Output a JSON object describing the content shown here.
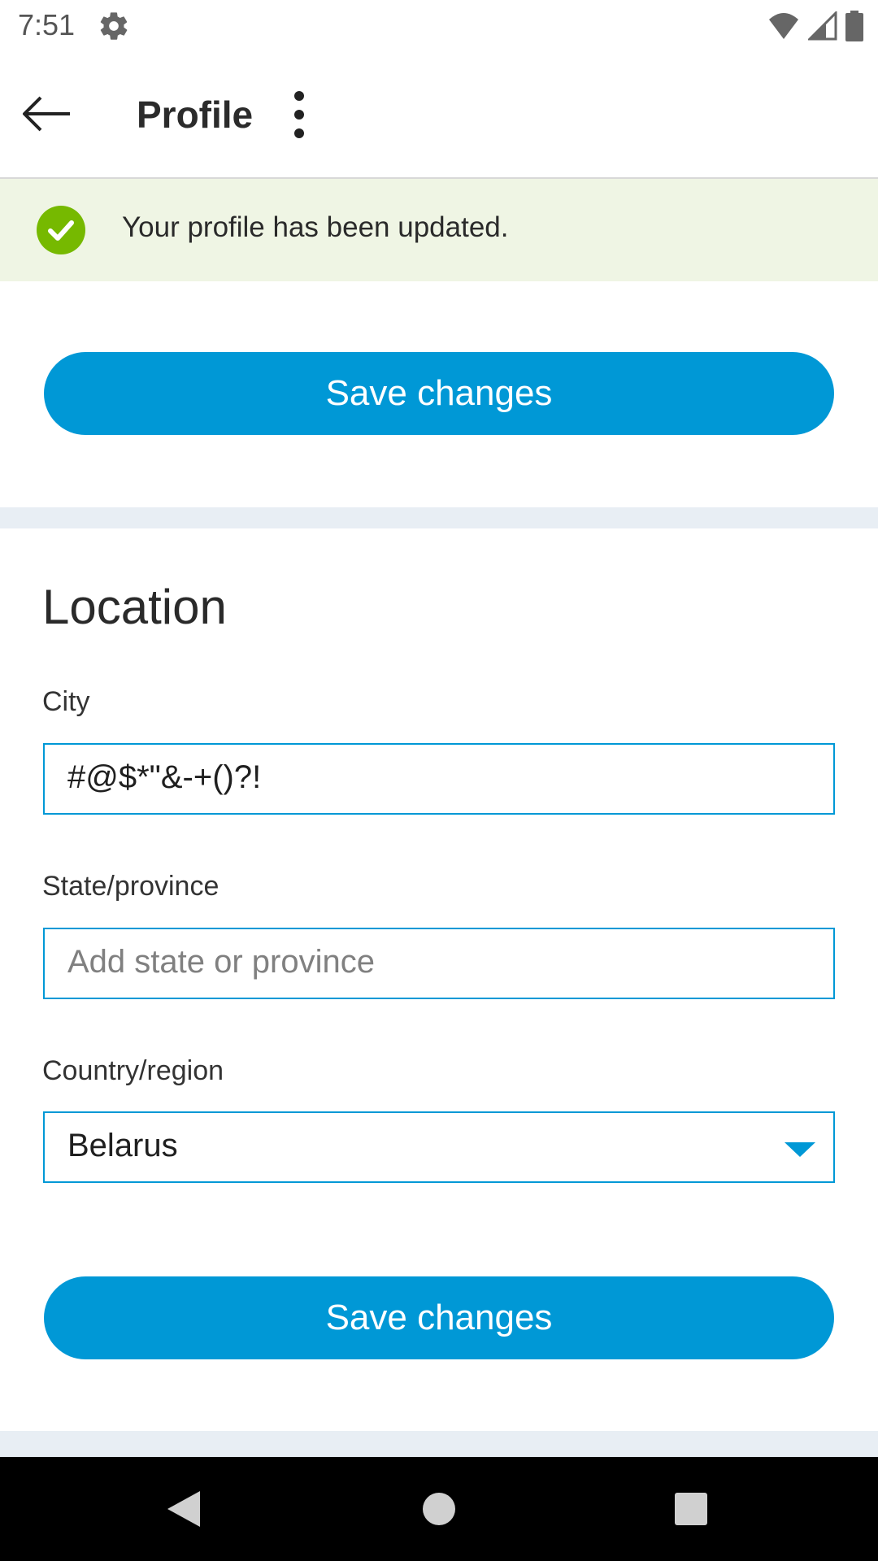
{
  "status_bar": {
    "time": "7:51"
  },
  "app_bar": {
    "title": "Profile"
  },
  "banner": {
    "message": "Your profile has been updated.",
    "accent": "#76b900"
  },
  "buttons": {
    "save_top": "Save changes",
    "save_bottom": "Save changes",
    "color": "#0098d6"
  },
  "location": {
    "heading": "Location",
    "city": {
      "label": "City",
      "value": "#@$*\"&-+()?!"
    },
    "state": {
      "label": "State/province",
      "placeholder": "Add state or province"
    },
    "country": {
      "label": "Country/region",
      "value": "Belarus"
    }
  },
  "icons": {
    "status": [
      "gear-icon",
      "wifi-icon",
      "signal-icon",
      "battery-icon"
    ],
    "app_bar": [
      "back-arrow-icon",
      "more-vert-icon"
    ],
    "nav": [
      "nav-back-icon",
      "nav-home-icon",
      "nav-recents-icon"
    ]
  }
}
